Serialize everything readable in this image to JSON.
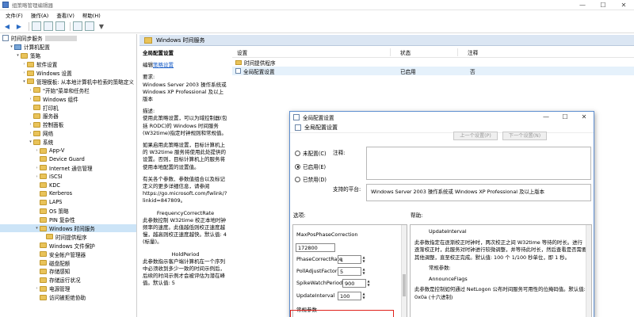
{
  "window": {
    "title": "组策略管理编辑器",
    "controls": [
      "—",
      "☐",
      "✕"
    ]
  },
  "menu": [
    "文件(F)",
    "操作(A)",
    "查看(V)",
    "帮助(H)"
  ],
  "tree": {
    "root_label": "时间同步服务",
    "items": [
      {
        "label": "计算机配置",
        "indent": 1,
        "icon": "pc",
        "tw": "▾"
      },
      {
        "label": "策略",
        "indent": 2,
        "icon": "folder",
        "tw": "▾"
      },
      {
        "label": "软件设置",
        "indent": 3,
        "icon": "folder",
        "tw": "›"
      },
      {
        "label": "Windows 设置",
        "indent": 3,
        "icon": "folder",
        "tw": "›"
      },
      {
        "label": "管理模板: 从本地计算机中检索的策略定义",
        "indent": 3,
        "icon": "folder",
        "tw": "▾"
      },
      {
        "label": "\"开始\"菜单和任务栏",
        "indent": 4,
        "icon": "folder",
        "tw": "›"
      },
      {
        "label": "Windows 组件",
        "indent": 4,
        "icon": "folder",
        "tw": "›"
      },
      {
        "label": "打印机",
        "indent": 4,
        "icon": "folder",
        "tw": ""
      },
      {
        "label": "服务器",
        "indent": 4,
        "icon": "folder",
        "tw": ""
      },
      {
        "label": "控制面板",
        "indent": 4,
        "icon": "folder",
        "tw": "›"
      },
      {
        "label": "网络",
        "indent": 4,
        "icon": "folder",
        "tw": "›"
      },
      {
        "label": "系统",
        "indent": 4,
        "icon": "folder",
        "tw": "▾"
      },
      {
        "label": "App-V",
        "indent": 5,
        "icon": "folder",
        "tw": "›"
      },
      {
        "label": "Device Guard",
        "indent": 5,
        "icon": "folder",
        "tw": ""
      },
      {
        "label": "Internet 通信管理",
        "indent": 5,
        "icon": "folder",
        "tw": "›"
      },
      {
        "label": "iSCSI",
        "indent": 5,
        "icon": "folder",
        "tw": "›"
      },
      {
        "label": "KDC",
        "indent": 5,
        "icon": "folder",
        "tw": ""
      },
      {
        "label": "Kerberos",
        "indent": 5,
        "icon": "folder",
        "tw": ""
      },
      {
        "label": "LAPS",
        "indent": 5,
        "icon": "folder",
        "tw": ""
      },
      {
        "label": "OS 策略",
        "indent": 5,
        "icon": "folder",
        "tw": ""
      },
      {
        "label": "PIN 复杂性",
        "indent": 5,
        "icon": "folder",
        "tw": ""
      },
      {
        "label": "Windows 时间服务",
        "indent": 5,
        "icon": "folder",
        "tw": "▾",
        "selected": true
      },
      {
        "label": "时间提供程序",
        "indent": 6,
        "icon": "folder",
        "tw": ""
      },
      {
        "label": "Windows 文件保护",
        "indent": 5,
        "icon": "folder",
        "tw": ""
      },
      {
        "label": "安全帐户管理器",
        "indent": 5,
        "icon": "folder",
        "tw": ""
      },
      {
        "label": "磁盘配额",
        "indent": 5,
        "icon": "folder",
        "tw": ""
      },
      {
        "label": "存储感知",
        "indent": 5,
        "icon": "folder",
        "tw": ""
      },
      {
        "label": "存储运行状况",
        "indent": 5,
        "icon": "folder",
        "tw": ""
      },
      {
        "label": "电源管理",
        "indent": 5,
        "icon": "folder",
        "tw": "›"
      },
      {
        "label": "访问被拒绝协助",
        "indent": 5,
        "icon": "folder",
        "tw": ""
      }
    ]
  },
  "header": {
    "title": "Windows 时间服务"
  },
  "description": {
    "title": "全局配置设置",
    "edit_prefix": "编辑",
    "edit_link": "策略设置",
    "req_label": "要求:",
    "req_text": "Windows Server 2003 操作系统或 Windows XP Professional 及以上版本",
    "desc_label": "描述:",
    "desc_text": "使用此策略设置，可以为域控制器(包括 RODC)的 Windows 时间服务(W32time)指定时钟规则和常规值。",
    "p2": "如果启用此策略设置，目标计算机上的 W32time 服务将使用此处提供的设置。否则，目标计算机上的服务将使用本地配置的设置值。",
    "p3": "有关各个参数、参数值组合以及标记定义的更多详细信息，请参阅 https://go.microsoft.com/fwlink/?linkid=847809。",
    "p4_title": "FrequencyCorrectRate",
    "p4": "此参数控制 W32time 校正本地时钟频率的速度。此值越低则校正速度越慢，越高则校正速度越快。默认值: 4 (标量)。",
    "p5_title": "HoldPeriod",
    "p5": "此参数指示客户端计算机在一个序列中必须收到多少一致的时间示例后，后续的时间示例才会被评估为潜在峰值。默认值: 5"
  },
  "grid": {
    "columns": [
      "设置",
      "状态",
      "注释"
    ],
    "rows": [
      {
        "name": "时间提供程序",
        "icon": "folder",
        "state": "",
        "comment": ""
      },
      {
        "name": "全局配置设置",
        "icon": "policy",
        "state": "已启用",
        "comment": "否"
      }
    ]
  },
  "dialog": {
    "title": "全局配置设置",
    "subtitle": "全局配置设置",
    "prev_button": "上一个设置(P)",
    "next_button": "下一个设置(N)",
    "radios": [
      "未配置(C)",
      "已启用(E)",
      "已禁用(D)"
    ],
    "selected_radio": 1,
    "comment_label": "注释:",
    "supported_label": "支持的平台:",
    "supported_text": "Windows Server 2003 操作系统或 Windows XP Professional 及以上版本",
    "options_label": "选项:",
    "help_label": "帮助:",
    "options": [
      {
        "label": "MaxPosPhaseCorrection",
        "value": "172800"
      },
      {
        "label": "PhaseCorrectRate",
        "value": "1"
      },
      {
        "label": "PollAdjustFactor",
        "value": "5"
      },
      {
        "label": "SpikeWatchPeriod",
        "value": "900"
      },
      {
        "label": "UpdateInterval",
        "value": "100"
      }
    ],
    "options_section": "常规参数",
    "help_lines": [
      {
        "text": "UpdateInterval",
        "indent": true
      },
      {
        "text": "此参数指定在逐渐校正时钟时，两次校正之间 W32time 等待的时长。进行逐渐校正时，此服务对时钟进行较微调整，并等待此时长，然后查看是否需要其他调整，直至校正完成。默认值: 100 个 1/100 秒单位，即 1 秒。",
        "indent": false
      },
      {
        "text": "常规参数:",
        "indent": true
      },
      {
        "text": "AnnounceFlags",
        "indent": true
      },
      {
        "text": "此参数是控制如何通过 NetLogon 公布时间服务可用性的位掩码值。默认值: 0x0a (十六进制)",
        "indent": false
      }
    ]
  }
}
